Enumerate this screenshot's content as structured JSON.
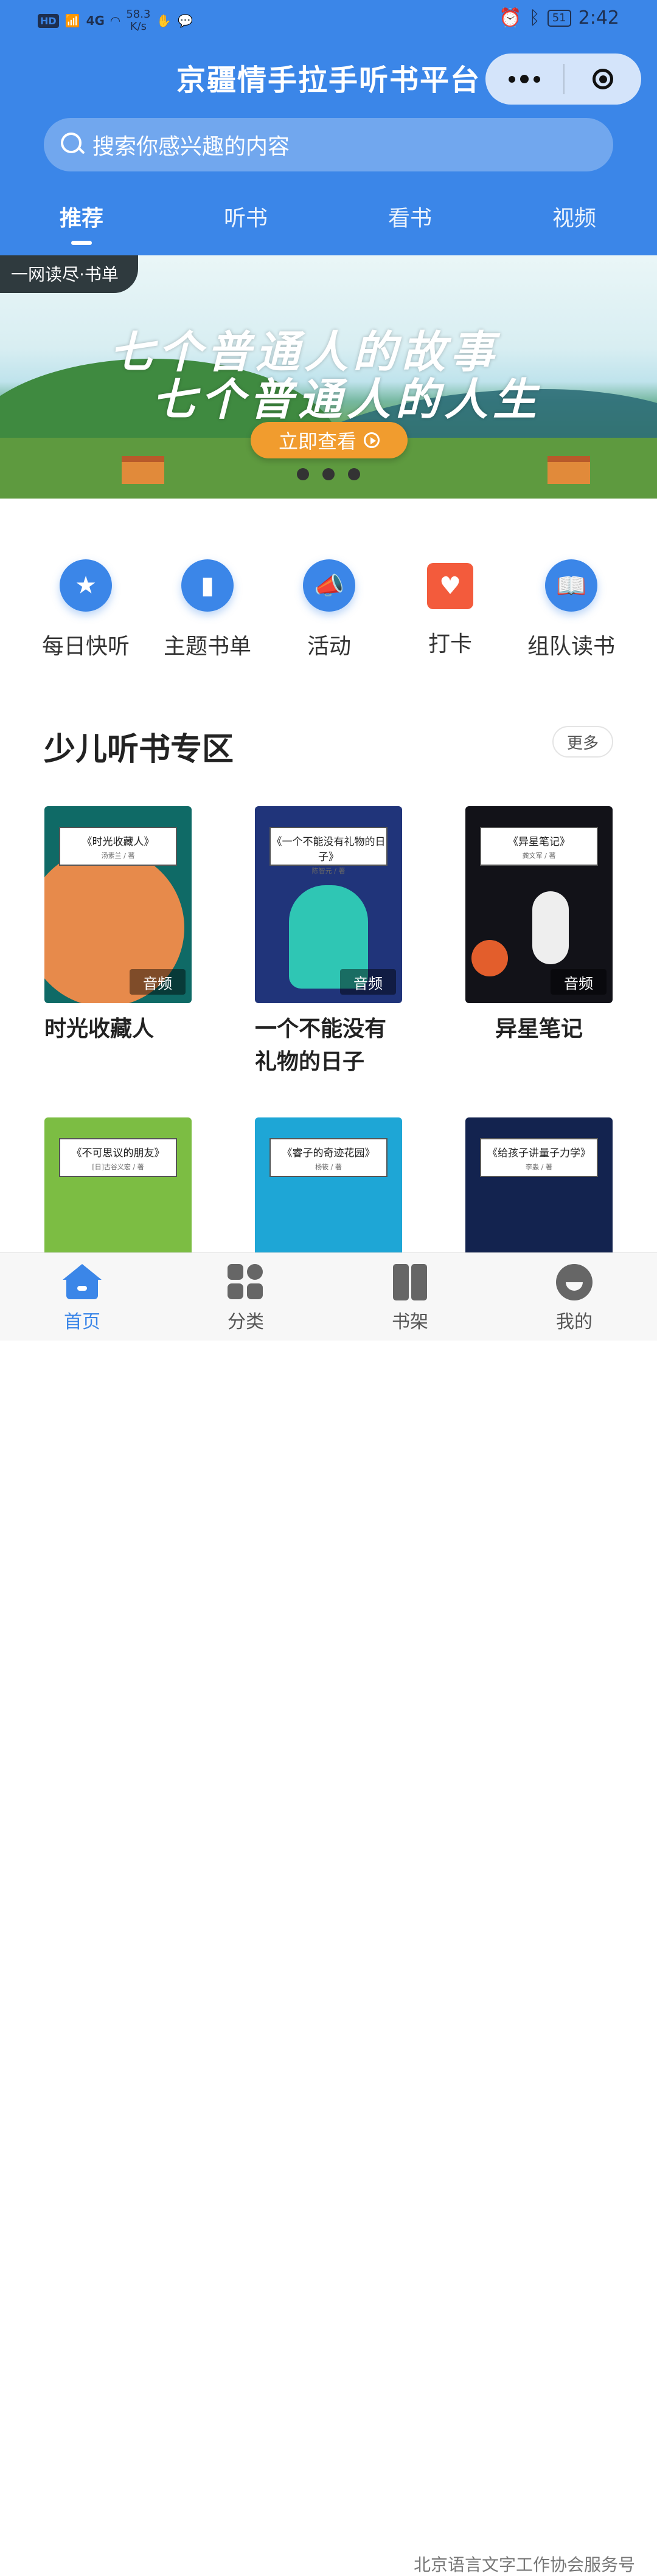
{
  "status_bar": {
    "network": "4G",
    "hd": "HD",
    "speed": "58.3",
    "speed_unit": "K/s",
    "battery": "51",
    "time": "2:42"
  },
  "header": {
    "title": "京疆情手拉手听书平台",
    "search_placeholder": "搜索你感兴趣的内容",
    "tabs": [
      {
        "label": "推荐"
      },
      {
        "label": "听书"
      },
      {
        "label": "看书"
      },
      {
        "label": "视频"
      }
    ]
  },
  "banner": {
    "tag": "一网读尽·书单",
    "line1": "七个普通人的故事",
    "line2": "七个普通人的人生",
    "button": "立即查看",
    "dot_count": 3
  },
  "quick_links": [
    {
      "label": "每日快听",
      "icon": "book-star-icon"
    },
    {
      "label": "主题书单",
      "icon": "book-list-icon"
    },
    {
      "label": "活动",
      "icon": "megaphone-icon"
    },
    {
      "label": "打卡",
      "icon": "calendar-heart-icon"
    },
    {
      "label": "组队读书",
      "icon": "open-book-icon"
    }
  ],
  "section": {
    "title": "少儿听书专区",
    "more": "更多",
    "books": [
      {
        "title": "时光收藏人",
        "cover_title": "《时光收藏人》",
        "author": "汤素兰 / 著",
        "badge": "音频"
      },
      {
        "title": "一个不能没有礼物的日子",
        "cover_title": "《一个不能没有礼物的日子》",
        "author": "陈智元 / 著",
        "badge": "音频"
      },
      {
        "title": "异星笔记",
        "cover_title": "《异星笔记》",
        "author": "龚文军 / 著",
        "badge": "音频"
      },
      {
        "title": "",
        "cover_title": "《不可思议的朋友》",
        "author": "[日]古谷义宏 / 著",
        "badge": ""
      },
      {
        "title": "",
        "cover_title": "《睿子的奇迹花园》",
        "author": "杨筱 / 著",
        "badge": ""
      },
      {
        "title": "",
        "cover_title": "《给孩子讲量子力学》",
        "author": "李淼 / 著",
        "badge": ""
      }
    ]
  },
  "bottom_nav": [
    {
      "label": "首页",
      "icon": "home-icon",
      "active": true
    },
    {
      "label": "分类",
      "icon": "category-icon",
      "active": false
    },
    {
      "label": "书架",
      "icon": "bookshelf-icon",
      "active": false
    },
    {
      "label": "我的",
      "icon": "profile-icon",
      "active": false
    }
  ],
  "watermark": "北京语言文字工作协会服务号",
  "colors": {
    "primary": "#3b86e8",
    "banner_button": "#f19c2e",
    "checkin": "#f35b3c"
  }
}
